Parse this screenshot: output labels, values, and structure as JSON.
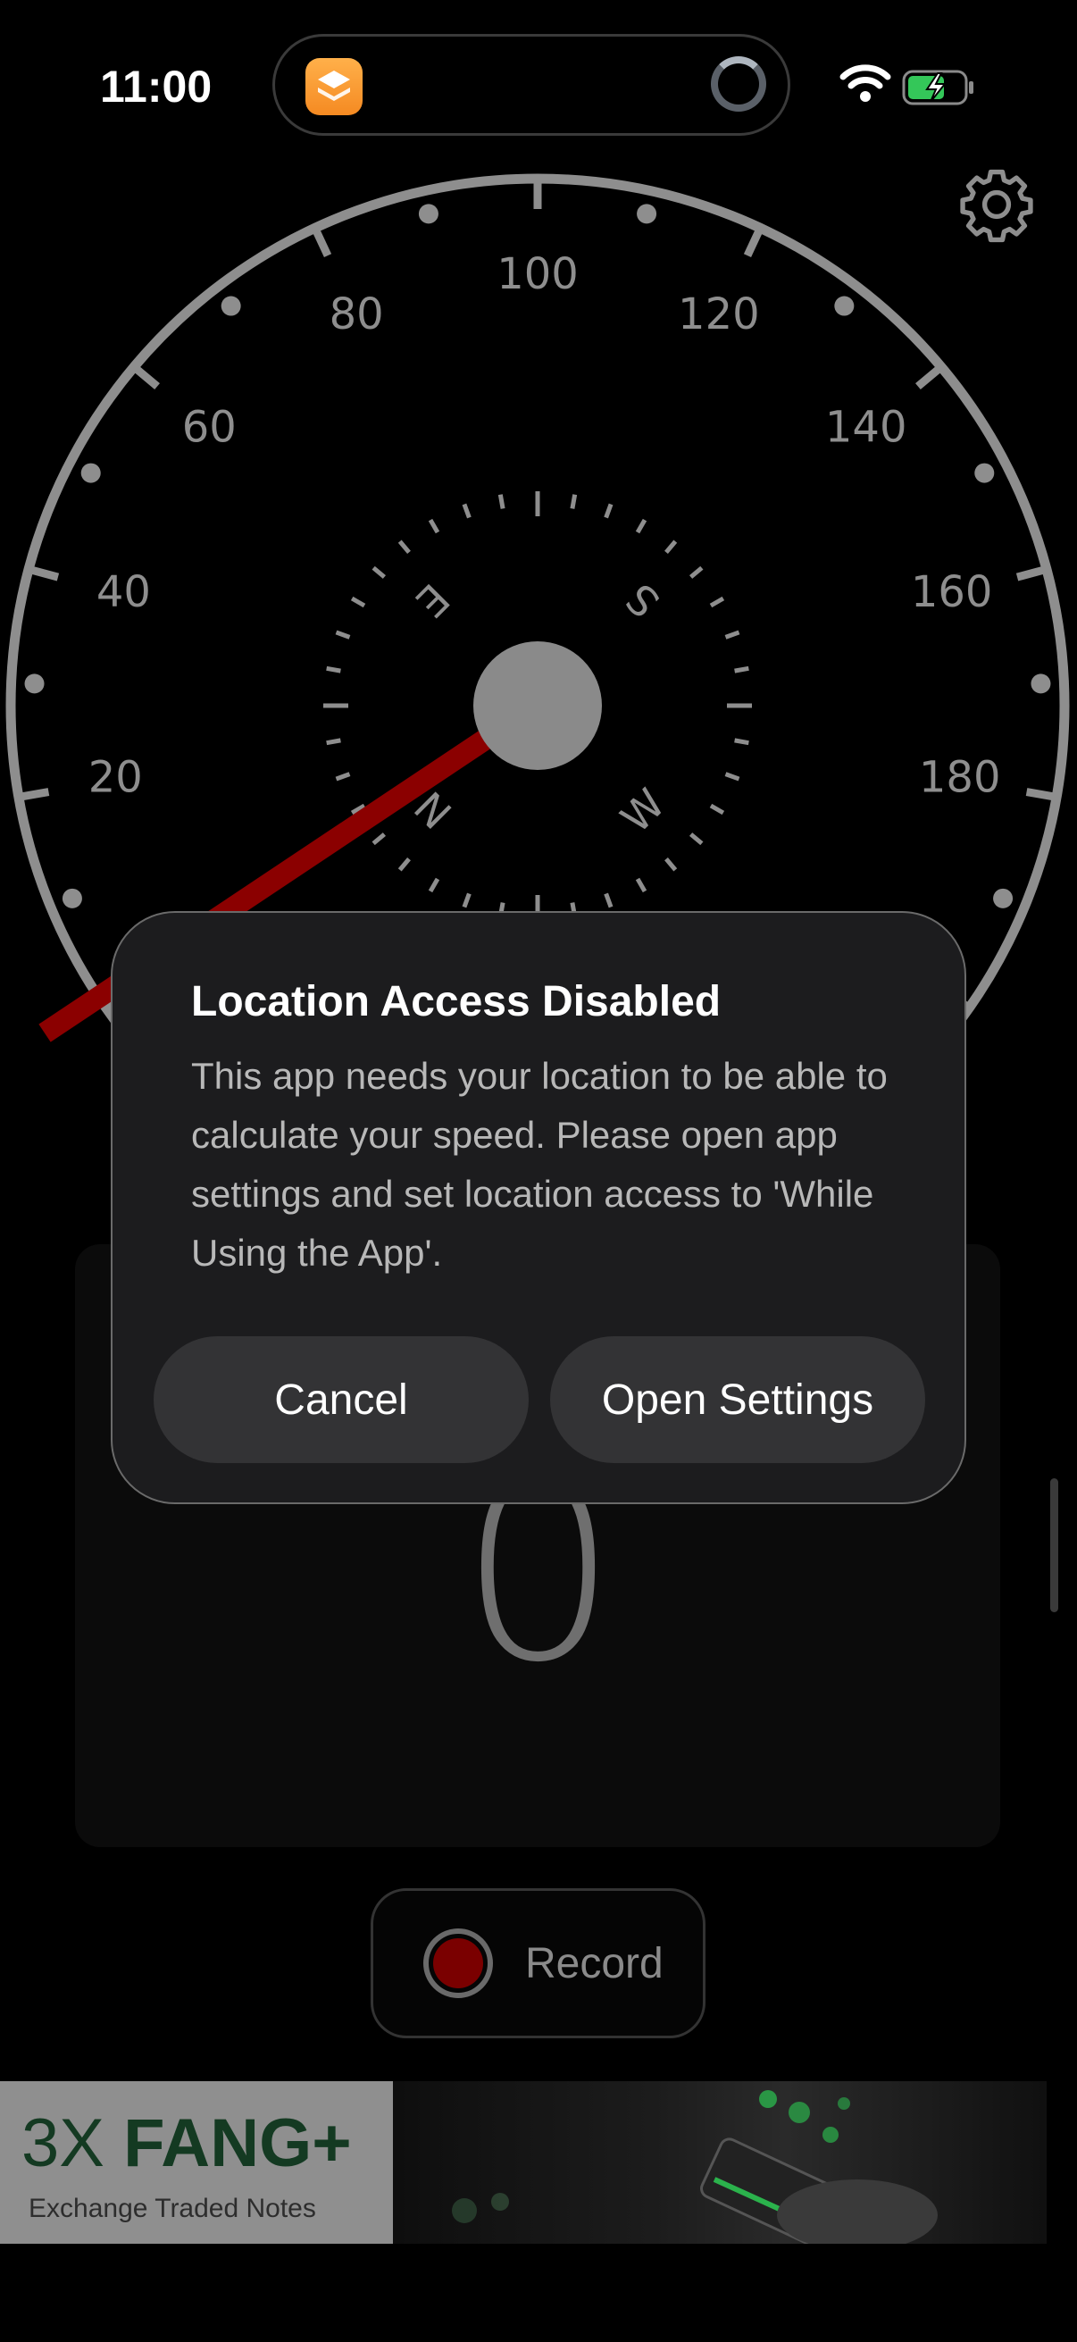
{
  "status_bar": {
    "time": "11:00",
    "icons": [
      "app-icon",
      "activity-ring-icon",
      "wifi-icon",
      "battery-charging-icon"
    ]
  },
  "settings_icon": "gear-icon",
  "speedometer": {
    "tick_labels": [
      "20",
      "40",
      "60",
      "80",
      "100",
      "120",
      "140",
      "160",
      "180"
    ],
    "compass": [
      "N",
      "E",
      "S",
      "W"
    ],
    "needle_color": "#8b0000"
  },
  "speed": {
    "value": "0"
  },
  "record": {
    "label": "Record"
  },
  "ad": {
    "title_prefix": "3X ",
    "title_bold": "FANG+",
    "subtitle": "Exchange Traded Notes"
  },
  "dialog": {
    "title": "Location Access Disabled",
    "message": "This app needs your location to be able to calculate your speed. Please open app settings and set location access to 'While Using the App'.",
    "cancel_label": "Cancel",
    "open_settings_label": "Open Settings"
  }
}
